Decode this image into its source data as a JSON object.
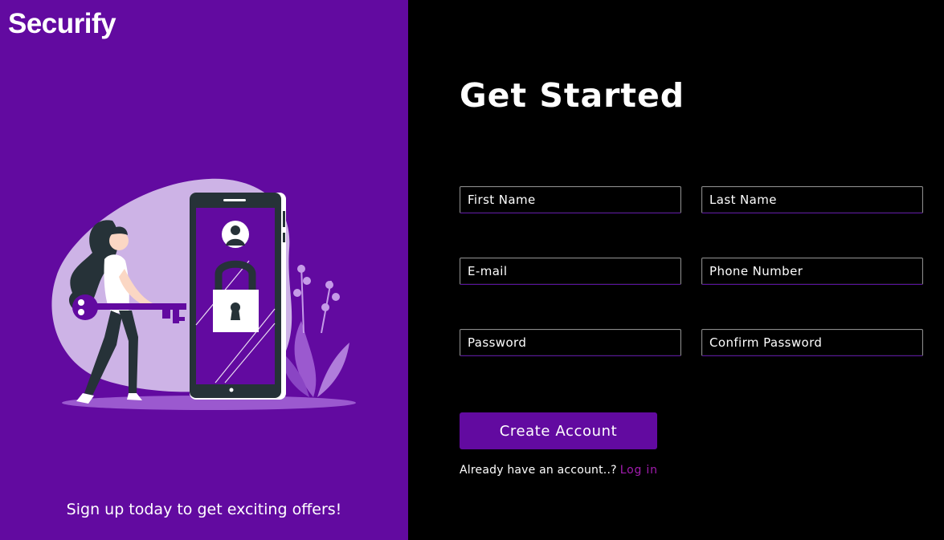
{
  "brand": {
    "name": "Securify"
  },
  "left_panel": {
    "tagline": "Sign up today to get exciting offers!",
    "illustration": "woman-with-key-phone-lock-illustration"
  },
  "form": {
    "title": "Get Started",
    "fields": {
      "first_name": {
        "placeholder": "First Name",
        "value": ""
      },
      "last_name": {
        "placeholder": "Last Name",
        "value": ""
      },
      "email": {
        "placeholder": "E-mail",
        "value": ""
      },
      "phone": {
        "placeholder": "Phone Number",
        "value": ""
      },
      "password": {
        "placeholder": "Password",
        "value": ""
      },
      "confirm_password": {
        "placeholder": "Confirm Password",
        "value": ""
      }
    },
    "submit_label": "Create Account",
    "login_prompt": "Already have an account..?",
    "login_link": "Log in"
  },
  "colors": {
    "primary": "#620aa0",
    "background": "#000000",
    "link": "#a21caf",
    "text": "#ffffff"
  }
}
